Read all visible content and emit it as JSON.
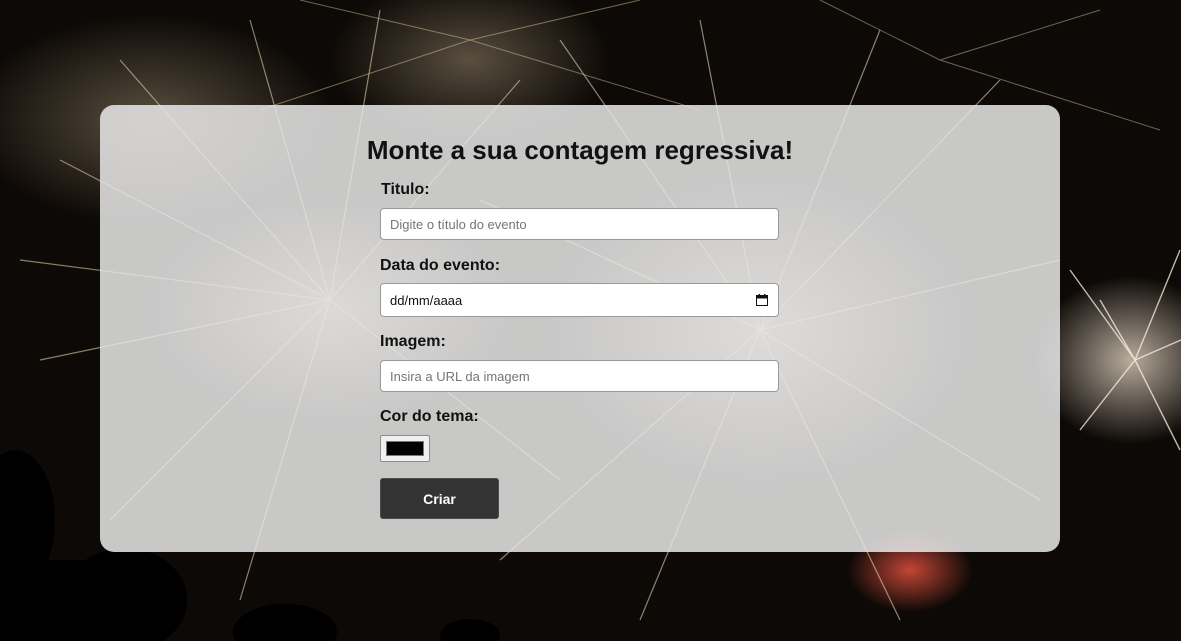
{
  "form": {
    "heading": "Monte a sua contagem regressiva!",
    "title_label": "Titulo:",
    "title_placeholder": "Digite o título do evento",
    "date_label": "Data do evento:",
    "date_placeholder": "dd/mm/aaaa",
    "image_label": "Imagem:",
    "image_placeholder": "Insira a URL da imagem",
    "color_label": "Cor do tema:",
    "color_value": "#000000",
    "submit_label": "Criar"
  },
  "icons": {
    "date_picker": "calendar-icon"
  },
  "colors": {
    "button_bg": "#333333",
    "card_bg": "#e8e8e8"
  }
}
